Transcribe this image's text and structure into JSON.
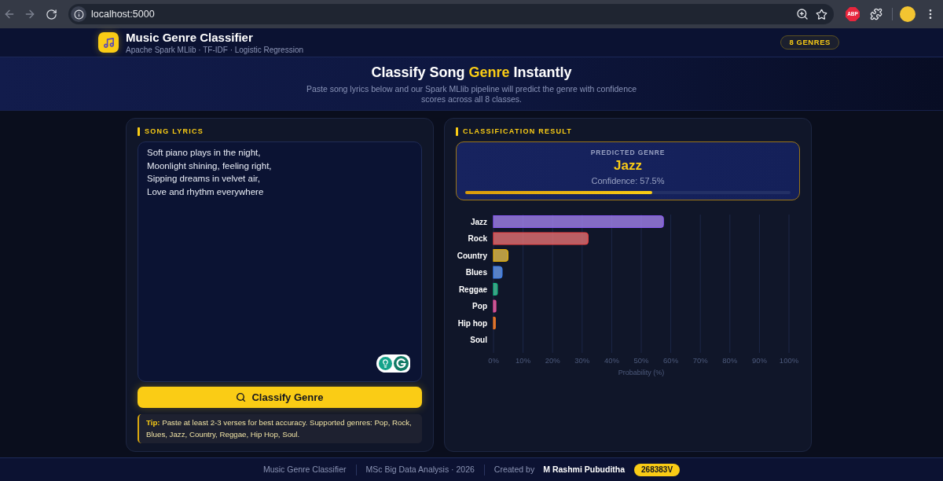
{
  "browser": {
    "url": "localhost:5000",
    "extension_label": "ABP"
  },
  "header": {
    "title": "Music Genre Classifier",
    "subtitle": "Apache Spark MLlib · TF-IDF · Logistic Regression",
    "badge": "8 GENRES"
  },
  "hero": {
    "title_parts": [
      {
        "text": "Classify Song",
        "accent": false
      },
      {
        "text": "Genre",
        "accent": true
      },
      {
        "text": "Instantly",
        "accent": false
      }
    ],
    "subtitle": "Paste song lyrics below and our Spark MLlib pipeline will predict the genre with confidence scores across all 8 classes."
  },
  "lyrics_panel": {
    "heading": "SONG LYRICS",
    "lyrics": "Soft piano plays in the night,\nMoonlight shining, feeling right,\nSipping dreams in velvet air,\nLove and rhythm everywhere",
    "button": "Classify Genre",
    "tip": "**Tip:** Paste at least 2-3 verses for best accuracy. Supported genres: Pop, Rock, Blues, Jazz, Country, Reggae, Hip Hop, Soul."
  },
  "result_panel": {
    "heading": "CLASSIFICATION RESULT",
    "prediction": {
      "label": "PREDICTED GENRE",
      "genre": "Jazz",
      "confidence": "Confidence: 57.5%",
      "level": 0.575
    },
    "chart_data": {
      "type": "bar",
      "orientation": "horizontal",
      "grid": true,
      "xlabel": "Probability (%)",
      "categories": [
        "Jazz",
        "Rock",
        "Country",
        "Blues",
        "Reggae",
        "Pop",
        "Hip hop",
        "Soul"
      ],
      "series": [
        {
          "colors": [
            "#8b5cf6",
            "#ef4444",
            "#eab308",
            "#3b82f6",
            "#10b981",
            "#ec4899",
            "#f97316",
            "#06b6d4"
          ],
          "values": [
            57.5,
            32.0,
            4.9,
            2.9,
            1.3,
            0.8,
            0.6,
            0
          ]
        }
      ],
      "xlim": [
        0,
        100
      ],
      "xticks": [
        {
          "value": 0,
          "label": "0%"
        },
        {
          "value": 10,
          "label": "10%"
        },
        {
          "value": 20,
          "label": "20%"
        },
        {
          "value": 30,
          "label": "30%"
        },
        {
          "value": 40,
          "label": "40%"
        },
        {
          "value": 50,
          "label": "50%"
        },
        {
          "value": 60,
          "label": "60%"
        },
        {
          "value": 70,
          "label": "70%"
        },
        {
          "value": 80,
          "label": "80%"
        },
        {
          "value": 90,
          "label": "90%"
        },
        {
          "value": 100,
          "label": "100%"
        }
      ]
    }
  },
  "footer": {
    "items": [
      {
        "text": "Music Genre Classifier"
      },
      {
        "text": "MSc Big Data Analysis · 2026"
      }
    ],
    "credit_label": "Created by",
    "author": "M Rashmi Pubuditha",
    "student_id": "268383V"
  }
}
